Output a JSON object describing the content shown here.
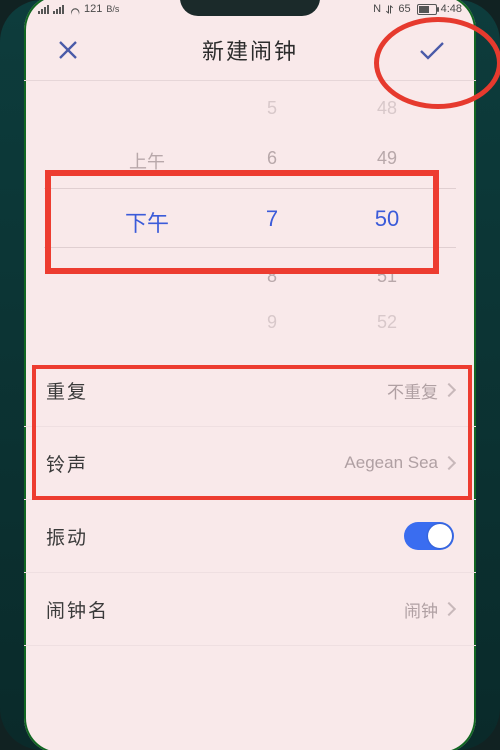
{
  "status": {
    "net_speed": "121",
    "net_unit": "B/s",
    "nfc": "N",
    "battery_pct": "65",
    "time": "4:48"
  },
  "header": {
    "title": "新建闹钟"
  },
  "picker": {
    "ampm": {
      "r1": "上午",
      "r2": "下午"
    },
    "hour": {
      "r0": "5",
      "r1": "6",
      "r2": "7",
      "r3": "8",
      "r4": "9"
    },
    "minute": {
      "r0": "48",
      "r1": "49",
      "r2": "50",
      "r3": "51",
      "r4": "52"
    }
  },
  "rows": {
    "repeat": {
      "label": "重复",
      "value": "不重复"
    },
    "ringtone": {
      "label": "铃声",
      "value": "Aegean Sea"
    },
    "vibrate": {
      "label": "振动"
    },
    "name": {
      "label": "闹钟名",
      "value": "闹钟"
    }
  },
  "colors": {
    "accent": "#3b5bd9",
    "toggle_on": "#3a6df0",
    "annotation": "#e63a2e"
  }
}
